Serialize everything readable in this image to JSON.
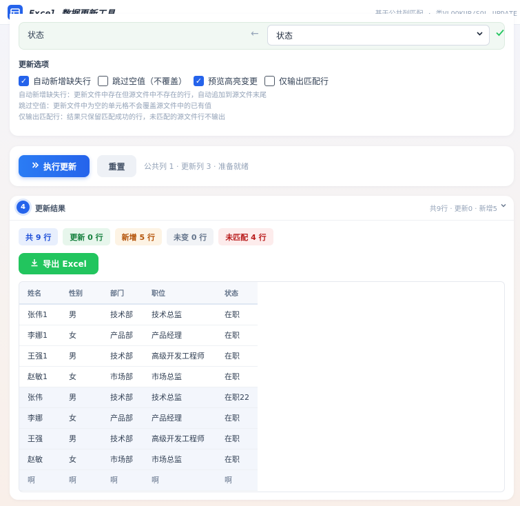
{
  "app": {
    "title": "Excel 数据更新工具",
    "subtitle": "基于公共列匹配 · 类VLOOKUP/SQL UPDATE"
  },
  "mapping": {
    "source_column": "状态",
    "target_selected": "状态"
  },
  "options": {
    "section_label": "更新选项",
    "items": [
      {
        "label": "自动新增缺失行",
        "checked": true
      },
      {
        "label": "跳过空值（不覆盖）",
        "checked": false
      },
      {
        "label": "预览高亮变更",
        "checked": true
      },
      {
        "label": "仅输出匹配行",
        "checked": false
      }
    ],
    "notes": [
      "自动新增缺失行：更新文件中存在但源文件中不存在的行，自动追加到源文件末尾",
      "跳过空值：更新文件中为空的单元格不会覆盖源文件中的已有值",
      "仅输出匹配行：结果只保留匹配成功的行，未匹配的源文件行不输出"
    ]
  },
  "actions": {
    "run_label": "执行更新",
    "reset_label": "重置",
    "status": "公共列 1 · 更新列 3 · 准备就绪"
  },
  "results": {
    "step": "4",
    "title": "更新结果",
    "summary": "共9行 · 更新0 · 新增5",
    "chips": [
      {
        "label": "共 9 行",
        "bg": "#e8effd",
        "fg": "#1d4ed8"
      },
      {
        "label": "更新 0 行",
        "bg": "#e7f6ec",
        "fg": "#15803d"
      },
      {
        "label": "新增 5 行",
        "bg": "#fdf3e4",
        "fg": "#b45309"
      },
      {
        "label": "未变 0 行",
        "bg": "#f1f3f6",
        "fg": "#64748b"
      },
      {
        "label": "未匹配 4 行",
        "bg": "#fdecec",
        "fg": "#b91c1c"
      }
    ],
    "export_label": "导出 Excel",
    "columns": [
      "姓名",
      "性别",
      "部门",
      "职位",
      "状态"
    ],
    "rows": [
      [
        "张伟1",
        "男",
        "技术部",
        "技术总监",
        "在职"
      ],
      [
        "李娜1",
        "女",
        "产品部",
        "产品经理",
        "在职"
      ],
      [
        "王强1",
        "男",
        "技术部",
        "高级开发工程师",
        "在职"
      ],
      [
        "赵敏1",
        "女",
        "市场部",
        "市场总监",
        "在职"
      ],
      [
        "张伟",
        "男",
        "技术部",
        "技术总监",
        "在职22"
      ],
      [
        "李娜",
        "女",
        "产品部",
        "产品经理",
        "在职"
      ],
      [
        "王强",
        "男",
        "技术部",
        "高级开发工程师",
        "在职"
      ],
      [
        "赵敏",
        "女",
        "市场部",
        "市场总监",
        "在职"
      ],
      [
        "啊",
        "啊",
        "啊",
        "啊",
        "啊"
      ]
    ]
  }
}
